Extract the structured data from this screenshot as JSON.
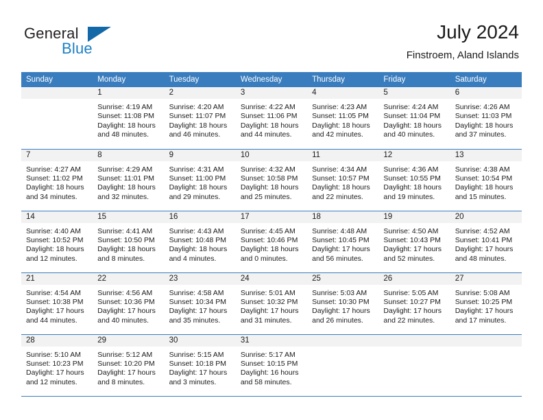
{
  "brand": {
    "word1": "General",
    "word2": "Blue",
    "flag_icon": "triangle-flag-icon",
    "accent_color": "#1368a8",
    "blue_text_color": "#1b7fc4"
  },
  "header": {
    "title": "July 2024",
    "subtitle": "Finstroem, Aland Islands"
  },
  "theme": {
    "header_row_color": "#3a7dbe",
    "daynum_bar_color": "#f2f2f2",
    "grid_line_color": "#3a7dbe",
    "text_color": "#1a1a1a"
  },
  "weekdays": [
    "Sunday",
    "Monday",
    "Tuesday",
    "Wednesday",
    "Thursday",
    "Friday",
    "Saturday"
  ],
  "weeks": [
    [
      {
        "day": "",
        "sunrise": "",
        "sunset": "",
        "daylight1": "",
        "daylight2": ""
      },
      {
        "day": "1",
        "sunrise": "Sunrise: 4:19 AM",
        "sunset": "Sunset: 11:08 PM",
        "daylight1": "Daylight: 18 hours",
        "daylight2": "and 48 minutes."
      },
      {
        "day": "2",
        "sunrise": "Sunrise: 4:20 AM",
        "sunset": "Sunset: 11:07 PM",
        "daylight1": "Daylight: 18 hours",
        "daylight2": "and 46 minutes."
      },
      {
        "day": "3",
        "sunrise": "Sunrise: 4:22 AM",
        "sunset": "Sunset: 11:06 PM",
        "daylight1": "Daylight: 18 hours",
        "daylight2": "and 44 minutes."
      },
      {
        "day": "4",
        "sunrise": "Sunrise: 4:23 AM",
        "sunset": "Sunset: 11:05 PM",
        "daylight1": "Daylight: 18 hours",
        "daylight2": "and 42 minutes."
      },
      {
        "day": "5",
        "sunrise": "Sunrise: 4:24 AM",
        "sunset": "Sunset: 11:04 PM",
        "daylight1": "Daylight: 18 hours",
        "daylight2": "and 40 minutes."
      },
      {
        "day": "6",
        "sunrise": "Sunrise: 4:26 AM",
        "sunset": "Sunset: 11:03 PM",
        "daylight1": "Daylight: 18 hours",
        "daylight2": "and 37 minutes."
      }
    ],
    [
      {
        "day": "7",
        "sunrise": "Sunrise: 4:27 AM",
        "sunset": "Sunset: 11:02 PM",
        "daylight1": "Daylight: 18 hours",
        "daylight2": "and 34 minutes."
      },
      {
        "day": "8",
        "sunrise": "Sunrise: 4:29 AM",
        "sunset": "Sunset: 11:01 PM",
        "daylight1": "Daylight: 18 hours",
        "daylight2": "and 32 minutes."
      },
      {
        "day": "9",
        "sunrise": "Sunrise: 4:31 AM",
        "sunset": "Sunset: 11:00 PM",
        "daylight1": "Daylight: 18 hours",
        "daylight2": "and 29 minutes."
      },
      {
        "day": "10",
        "sunrise": "Sunrise: 4:32 AM",
        "sunset": "Sunset: 10:58 PM",
        "daylight1": "Daylight: 18 hours",
        "daylight2": "and 25 minutes."
      },
      {
        "day": "11",
        "sunrise": "Sunrise: 4:34 AM",
        "sunset": "Sunset: 10:57 PM",
        "daylight1": "Daylight: 18 hours",
        "daylight2": "and 22 minutes."
      },
      {
        "day": "12",
        "sunrise": "Sunrise: 4:36 AM",
        "sunset": "Sunset: 10:55 PM",
        "daylight1": "Daylight: 18 hours",
        "daylight2": "and 19 minutes."
      },
      {
        "day": "13",
        "sunrise": "Sunrise: 4:38 AM",
        "sunset": "Sunset: 10:54 PM",
        "daylight1": "Daylight: 18 hours",
        "daylight2": "and 15 minutes."
      }
    ],
    [
      {
        "day": "14",
        "sunrise": "Sunrise: 4:40 AM",
        "sunset": "Sunset: 10:52 PM",
        "daylight1": "Daylight: 18 hours",
        "daylight2": "and 12 minutes."
      },
      {
        "day": "15",
        "sunrise": "Sunrise: 4:41 AM",
        "sunset": "Sunset: 10:50 PM",
        "daylight1": "Daylight: 18 hours",
        "daylight2": "and 8 minutes."
      },
      {
        "day": "16",
        "sunrise": "Sunrise: 4:43 AM",
        "sunset": "Sunset: 10:48 PM",
        "daylight1": "Daylight: 18 hours",
        "daylight2": "and 4 minutes."
      },
      {
        "day": "17",
        "sunrise": "Sunrise: 4:45 AM",
        "sunset": "Sunset: 10:46 PM",
        "daylight1": "Daylight: 18 hours",
        "daylight2": "and 0 minutes."
      },
      {
        "day": "18",
        "sunrise": "Sunrise: 4:48 AM",
        "sunset": "Sunset: 10:45 PM",
        "daylight1": "Daylight: 17 hours",
        "daylight2": "and 56 minutes."
      },
      {
        "day": "19",
        "sunrise": "Sunrise: 4:50 AM",
        "sunset": "Sunset: 10:43 PM",
        "daylight1": "Daylight: 17 hours",
        "daylight2": "and 52 minutes."
      },
      {
        "day": "20",
        "sunrise": "Sunrise: 4:52 AM",
        "sunset": "Sunset: 10:41 PM",
        "daylight1": "Daylight: 17 hours",
        "daylight2": "and 48 minutes."
      }
    ],
    [
      {
        "day": "21",
        "sunrise": "Sunrise: 4:54 AM",
        "sunset": "Sunset: 10:38 PM",
        "daylight1": "Daylight: 17 hours",
        "daylight2": "and 44 minutes."
      },
      {
        "day": "22",
        "sunrise": "Sunrise: 4:56 AM",
        "sunset": "Sunset: 10:36 PM",
        "daylight1": "Daylight: 17 hours",
        "daylight2": "and 40 minutes."
      },
      {
        "day": "23",
        "sunrise": "Sunrise: 4:58 AM",
        "sunset": "Sunset: 10:34 PM",
        "daylight1": "Daylight: 17 hours",
        "daylight2": "and 35 minutes."
      },
      {
        "day": "24",
        "sunrise": "Sunrise: 5:01 AM",
        "sunset": "Sunset: 10:32 PM",
        "daylight1": "Daylight: 17 hours",
        "daylight2": "and 31 minutes."
      },
      {
        "day": "25",
        "sunrise": "Sunrise: 5:03 AM",
        "sunset": "Sunset: 10:30 PM",
        "daylight1": "Daylight: 17 hours",
        "daylight2": "and 26 minutes."
      },
      {
        "day": "26",
        "sunrise": "Sunrise: 5:05 AM",
        "sunset": "Sunset: 10:27 PM",
        "daylight1": "Daylight: 17 hours",
        "daylight2": "and 22 minutes."
      },
      {
        "day": "27",
        "sunrise": "Sunrise: 5:08 AM",
        "sunset": "Sunset: 10:25 PM",
        "daylight1": "Daylight: 17 hours",
        "daylight2": "and 17 minutes."
      }
    ],
    [
      {
        "day": "28",
        "sunrise": "Sunrise: 5:10 AM",
        "sunset": "Sunset: 10:23 PM",
        "daylight1": "Daylight: 17 hours",
        "daylight2": "and 12 minutes."
      },
      {
        "day": "29",
        "sunrise": "Sunrise: 5:12 AM",
        "sunset": "Sunset: 10:20 PM",
        "daylight1": "Daylight: 17 hours",
        "daylight2": "and 8 minutes."
      },
      {
        "day": "30",
        "sunrise": "Sunrise: 5:15 AM",
        "sunset": "Sunset: 10:18 PM",
        "daylight1": "Daylight: 17 hours",
        "daylight2": "and 3 minutes."
      },
      {
        "day": "31",
        "sunrise": "Sunrise: 5:17 AM",
        "sunset": "Sunset: 10:15 PM",
        "daylight1": "Daylight: 16 hours",
        "daylight2": "and 58 minutes."
      },
      {
        "day": "",
        "sunrise": "",
        "sunset": "",
        "daylight1": "",
        "daylight2": ""
      },
      {
        "day": "",
        "sunrise": "",
        "sunset": "",
        "daylight1": "",
        "daylight2": ""
      },
      {
        "day": "",
        "sunrise": "",
        "sunset": "",
        "daylight1": "",
        "daylight2": ""
      }
    ]
  ]
}
